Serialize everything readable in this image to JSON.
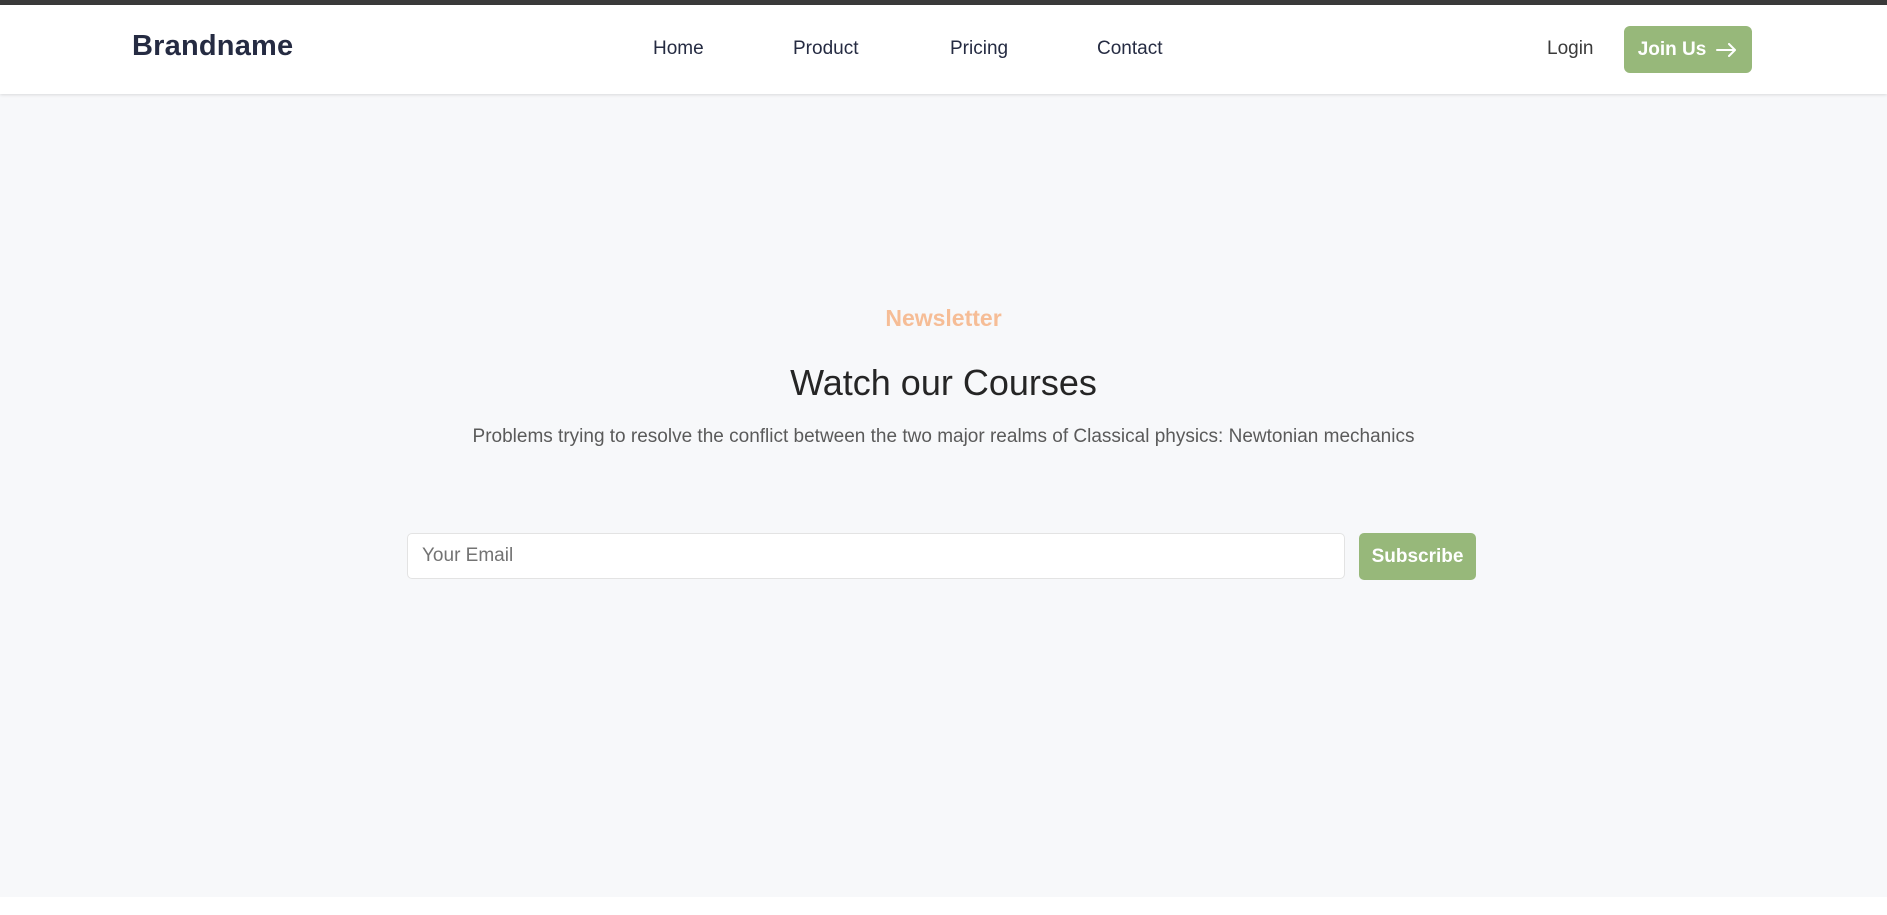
{
  "header": {
    "brand": "Brandname",
    "nav": [
      "Home",
      "Product",
      "Pricing",
      "Contact"
    ],
    "login_label": "Login",
    "join_label": "Join Us",
    "join_icon": "arrow-right-icon"
  },
  "newsletter": {
    "eyebrow": "Newsletter",
    "title": "Watch our Courses",
    "subtitle": "Problems trying to resolve the conflict between the two major realms of Classical physics: Newtonian mechanics",
    "email_placeholder": "Your Email",
    "subscribe_label": "Subscribe"
  },
  "colors": {
    "accent_green": "#97b87a",
    "eyebrow_orange": "#f6bd96",
    "brand_dark": "#252b42",
    "page_bg": "#f7f8fa"
  }
}
